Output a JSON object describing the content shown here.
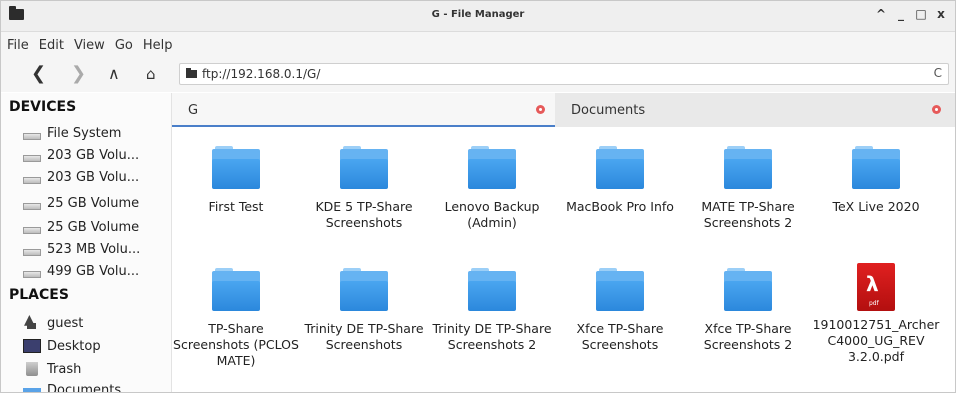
{
  "window": {
    "title": "G - File Manager",
    "controls": [
      "^",
      "_",
      "□",
      "x"
    ]
  },
  "menu": [
    "File",
    "Edit",
    "View",
    "Go",
    "Help"
  ],
  "toolbar": {
    "back": "❮",
    "forward": "❯",
    "up": "∧",
    "home": "⌂",
    "path": "ftp://192.168.0.1/G/",
    "reload": "C"
  },
  "sidebar": {
    "devices_header": "DEVICES",
    "devices": [
      "File System",
      "203 GB Volu...",
      "203 GB Volu...",
      "25 GB Volume",
      "25 GB Volume",
      "523 MB Volu...",
      "499 GB Volu..."
    ],
    "places_header": "PLACES",
    "places": [
      "guest",
      "Desktop",
      "Trash",
      "Documents"
    ]
  },
  "tabs": [
    {
      "label": "G",
      "active": true
    },
    {
      "label": "Documents",
      "active": false
    }
  ],
  "files": [
    {
      "name": "First Test",
      "type": "folder"
    },
    {
      "name": "KDE 5 TP-Share Screenshots",
      "type": "folder"
    },
    {
      "name": "Lenovo Backup (Admin)",
      "type": "folder"
    },
    {
      "name": "MacBook Pro Info",
      "type": "folder"
    },
    {
      "name": "MATE TP-Share Screenshots 2",
      "type": "folder"
    },
    {
      "name": "TeX Live 2020",
      "type": "folder"
    },
    {
      "name": "TP-Share Screenshots (PCLOS MATE)",
      "type": "folder"
    },
    {
      "name": "Trinity DE TP-Share Screenshots",
      "type": "folder"
    },
    {
      "name": "Trinity DE TP-Share Screenshots 2",
      "type": "folder"
    },
    {
      "name": "Xfce TP-Share Screenshots",
      "type": "folder"
    },
    {
      "name": "Xfce TP-Share Screenshots 2",
      "type": "folder"
    },
    {
      "name": "1910012751_Archer C4000_UG_REV 3.2.0.pdf",
      "type": "pdf"
    }
  ],
  "colors": {
    "accent": "#4a7fc9",
    "folder": "#2d8ce0",
    "pdf": "#d01a1a",
    "tab_close": "#e65a5a"
  }
}
